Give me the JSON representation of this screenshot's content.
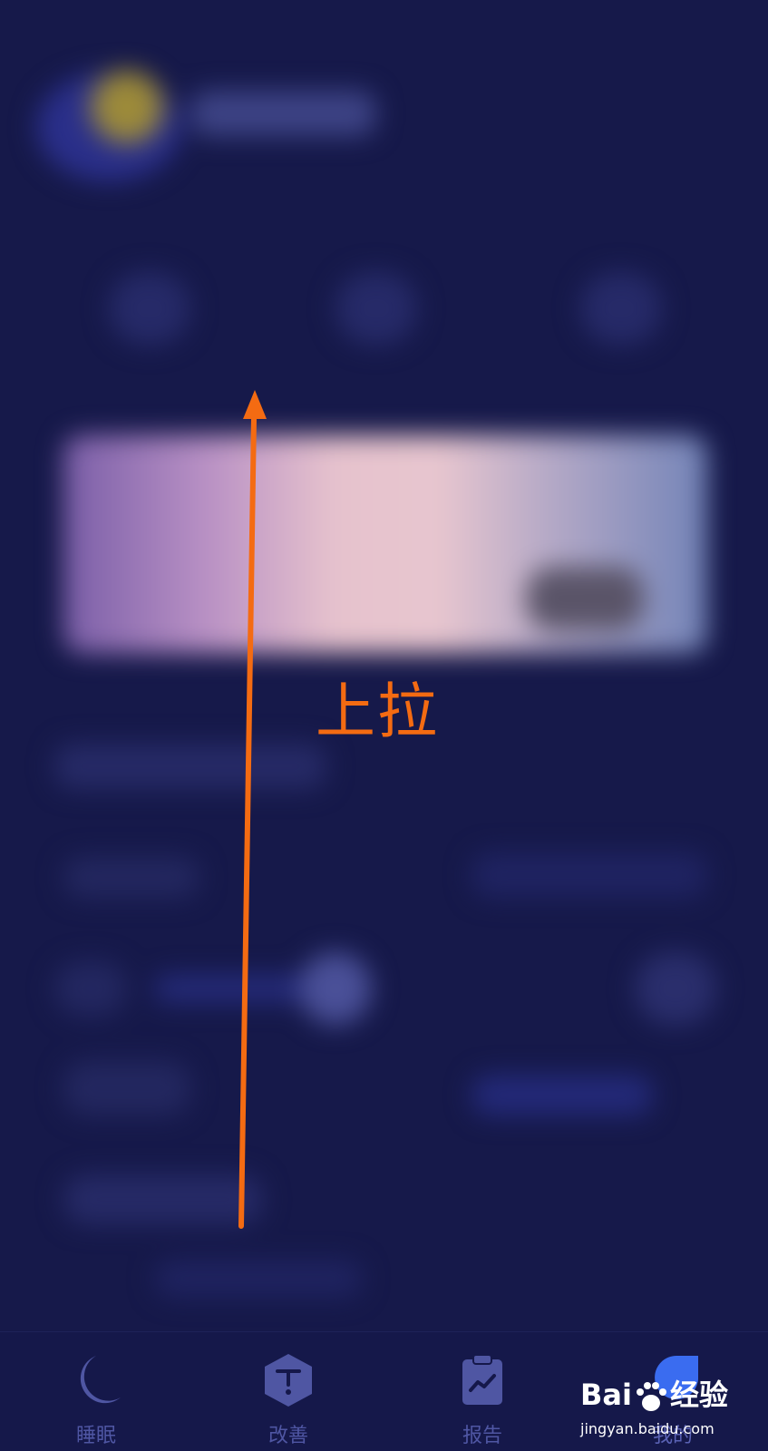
{
  "gesture": {
    "instruction": "上拉",
    "color": "#f46b12"
  },
  "tabbar": {
    "items": [
      {
        "label": "睡眠",
        "icon": "moon-icon"
      },
      {
        "label": "改善",
        "icon": "improve-hexagon-icon"
      },
      {
        "label": "报告",
        "icon": "report-clipboard-icon"
      },
      {
        "label": "我的",
        "icon": "profile-droplet-icon"
      }
    ],
    "label_color": "#4f56a3"
  },
  "watermark": {
    "brand_prefix": "Bai",
    "brand_suffix": "经验",
    "url": "jingyan.baidu.com"
  },
  "colors": {
    "background": "#16194a",
    "banner_gradient": [
      "#7a5ea8",
      "#e6c2cd",
      "#7384b8"
    ]
  }
}
